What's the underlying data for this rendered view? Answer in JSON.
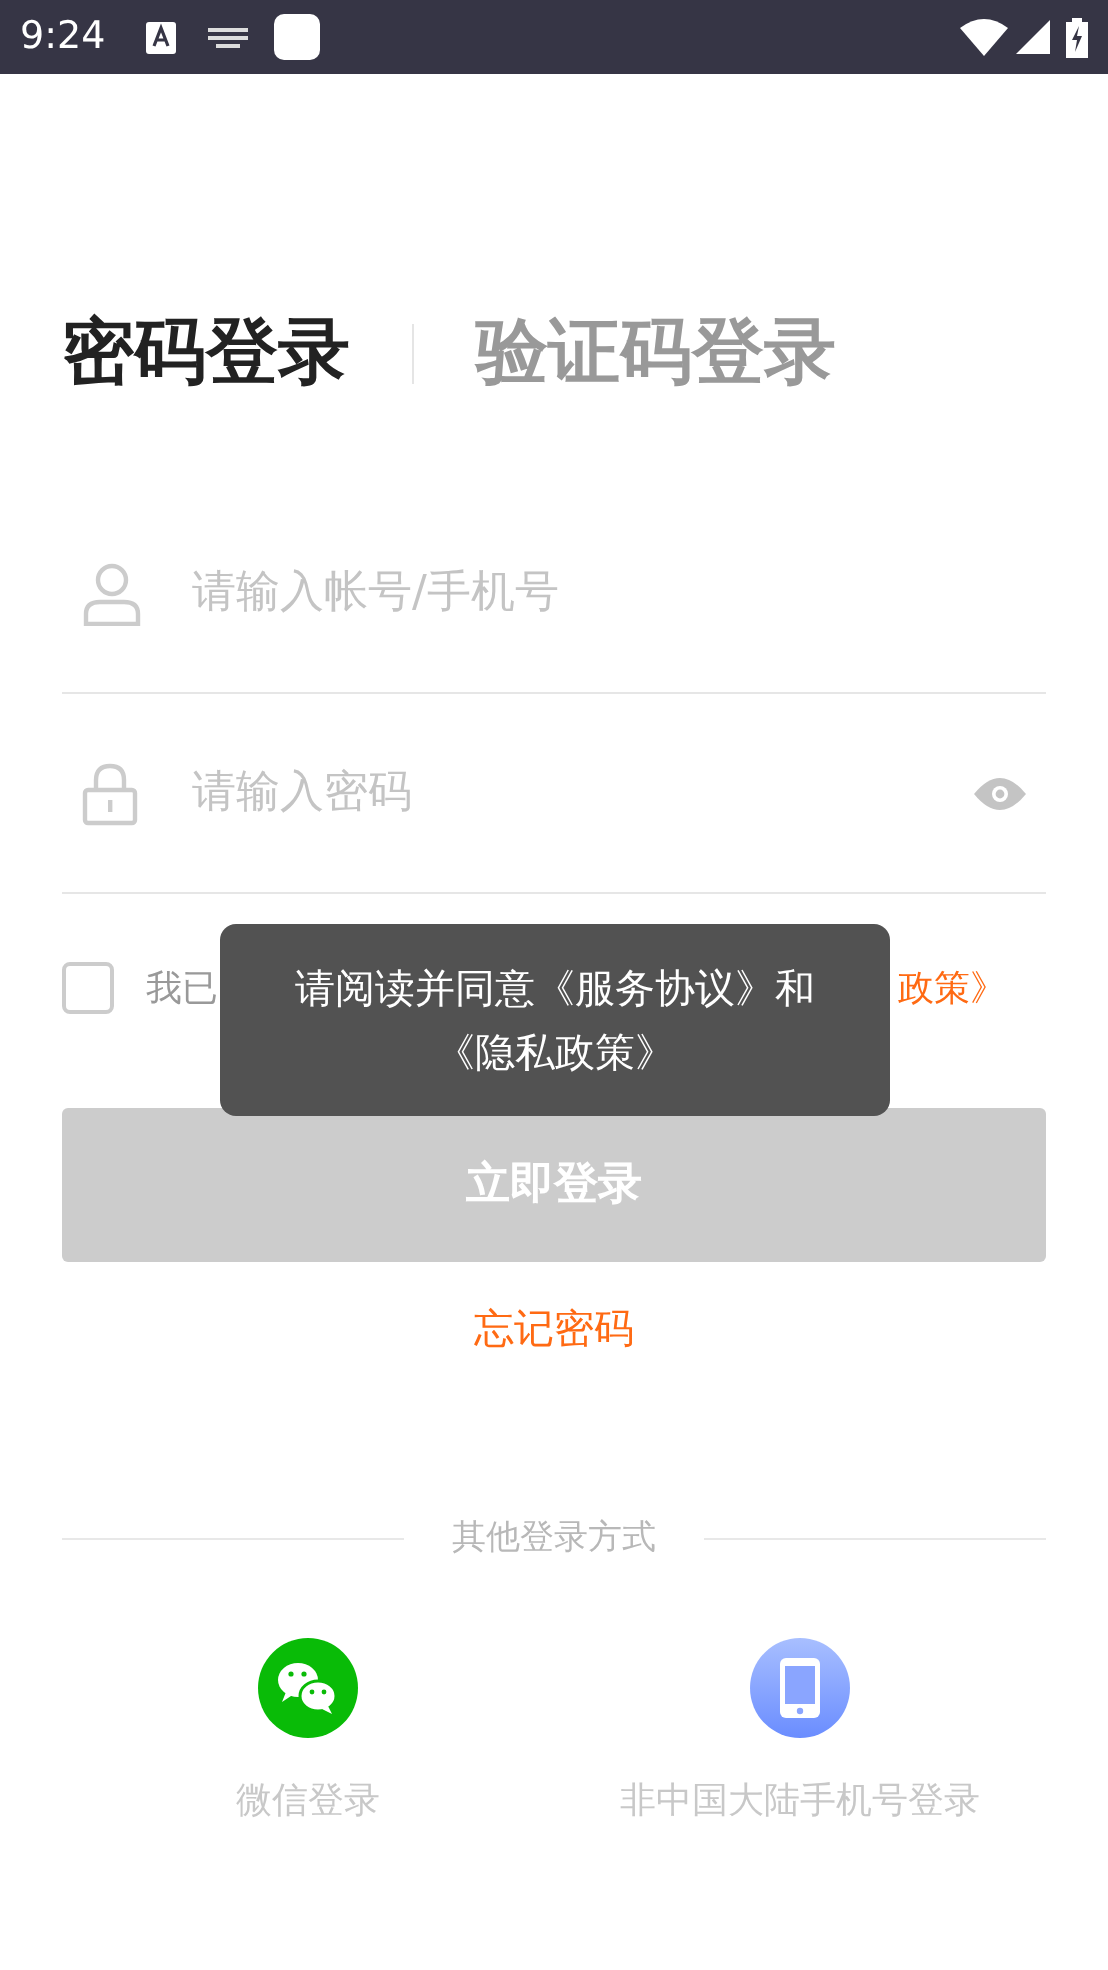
{
  "status_bar": {
    "time": "9:24"
  },
  "tabs": [
    {
      "label": "密码登录",
      "selected": true
    },
    {
      "label": "验证码登录",
      "selected": false
    }
  ],
  "fields": [
    {
      "kind": "account",
      "placeholder": "请输入帐号/手机号"
    },
    {
      "kind": "password",
      "placeholder": "请输入密码"
    }
  ],
  "agreement": {
    "checked": false,
    "visible_start": "我已",
    "visible_end": "政策》"
  },
  "login_button": {
    "label": "立即登录",
    "disabled": true
  },
  "forgot_password": "忘记密码",
  "other_methods": {
    "title": "其他登录方式",
    "items": [
      {
        "kind": "wechat",
        "label": "微信登录"
      },
      {
        "kind": "phone",
        "label": "非中国大陆手机号登录"
      }
    ]
  },
  "toast": {
    "text": "请阅读并同意《服务协议》和《隐私政策》"
  }
}
